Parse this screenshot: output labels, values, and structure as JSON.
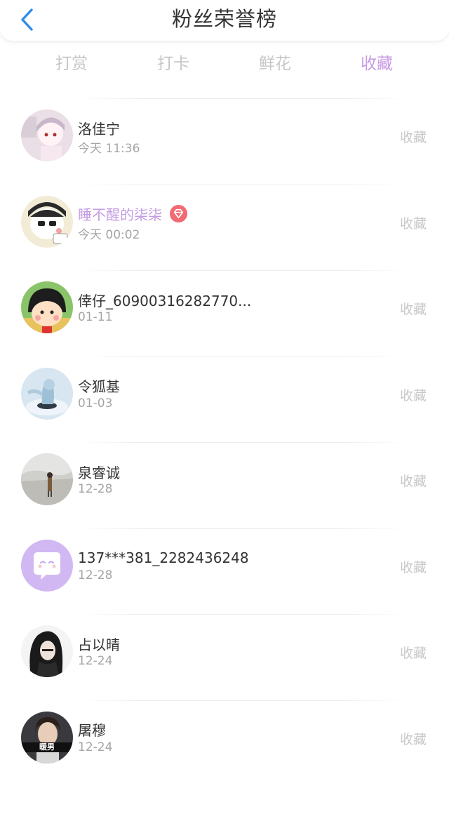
{
  "header": {
    "title": "粉丝荣誉榜",
    "back_icon": "chevron-left-icon",
    "accent": "#2e8ee8"
  },
  "tabs": [
    {
      "label": "打赏",
      "active": false
    },
    {
      "label": "打卡",
      "active": false
    },
    {
      "label": "鲜花",
      "active": false
    },
    {
      "label": "收藏",
      "active": true
    }
  ],
  "colors": {
    "active_tab": "#c79be6",
    "vip_name": "#c39be3",
    "vip_badge": "#f26a72"
  },
  "fans": [
    {
      "name": "洛佳宁",
      "date": "今天 11:36",
      "action": "收藏",
      "vip": false
    },
    {
      "name": "睡不醒的柒柒",
      "date": "今天 00:02",
      "action": "收藏",
      "vip": true
    },
    {
      "name": "倖仔_60900316282770...",
      "date": "01-11",
      "action": "收藏",
      "vip": false
    },
    {
      "name": "令狐基",
      "date": "01-03",
      "action": "收藏",
      "vip": false
    },
    {
      "name": "泉睿诚",
      "date": "12-28",
      "action": "收藏",
      "vip": false
    },
    {
      "name": "137***381_2282436248",
      "date": "12-28",
      "action": "收藏",
      "vip": false
    },
    {
      "name": "占以晴",
      "date": "12-24",
      "action": "收藏",
      "vip": false
    },
    {
      "name": "屠穆",
      "date": "12-24",
      "action": "收藏",
      "vip": false,
      "avatar_caption": "暖男"
    }
  ]
}
